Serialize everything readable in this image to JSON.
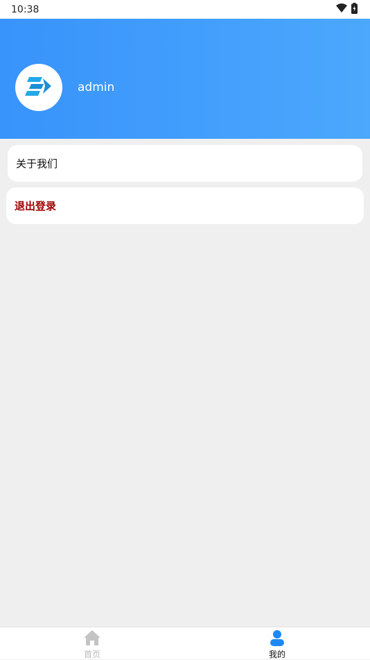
{
  "status_bar": {
    "time": "10:38",
    "icons": [
      "wifi-icon",
      "battery-charging-icon"
    ]
  },
  "profile": {
    "avatar_icon": "arrow-logo-icon",
    "username": "admin"
  },
  "menu": {
    "about_label": "关于我们",
    "logout_label": "退出登录"
  },
  "tab_bar": {
    "tabs": [
      {
        "label": "首页",
        "icon": "home-icon",
        "active": false
      },
      {
        "label": "我的",
        "icon": "user-icon",
        "active": true
      }
    ]
  },
  "colors": {
    "header_gradient_start": "#3893fb",
    "header_gradient_end": "#4ba8fc",
    "logout_text": "#a00000",
    "active_tab_icon": "#1e88f5",
    "inactive_tab_icon": "#c4c4c4",
    "background": "#efefef"
  }
}
